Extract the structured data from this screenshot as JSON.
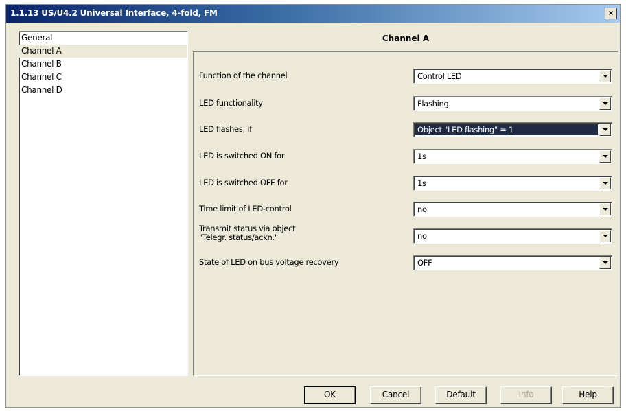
{
  "window": {
    "title": "1.1.13 US/U4.2 Universal Interface, 4-fold, FM",
    "close_label": "×"
  },
  "nav": {
    "items": [
      {
        "label": "General"
      },
      {
        "label": "Channel A"
      },
      {
        "label": "Channel B"
      },
      {
        "label": "Channel C"
      },
      {
        "label": "Channel D"
      }
    ],
    "selected": "Channel A"
  },
  "panel": {
    "heading": "Channel A",
    "rows": [
      {
        "label": "Function of the channel",
        "value": "Control LED"
      },
      {
        "label": "LED functionality",
        "value": "Flashing"
      },
      {
        "label": "LED flashes, if",
        "value": "Object \"LED flashing\" = 1"
      },
      {
        "label": "LED is switched ON for",
        "value": "1s"
      },
      {
        "label": "LED is switched OFF for",
        "value": "1s"
      },
      {
        "label": "Time limit of LED-control",
        "value": "no"
      },
      {
        "label_line1": "Transmit status via object",
        "label_line2": "\"Telegr. status/ackn.\"",
        "value": "no"
      },
      {
        "label": "State of LED on bus voltage recovery",
        "value": "OFF"
      }
    ]
  },
  "buttons": {
    "ok": "OK",
    "cancel": "Cancel",
    "default": "Default",
    "info": "Info",
    "help": "Help"
  },
  "colors": {
    "title_gradient_start": "#0a246a",
    "title_gradient_end": "#a6caf0",
    "dialog_face": "#ece9d8",
    "highlight_select": "#1f2a44"
  }
}
